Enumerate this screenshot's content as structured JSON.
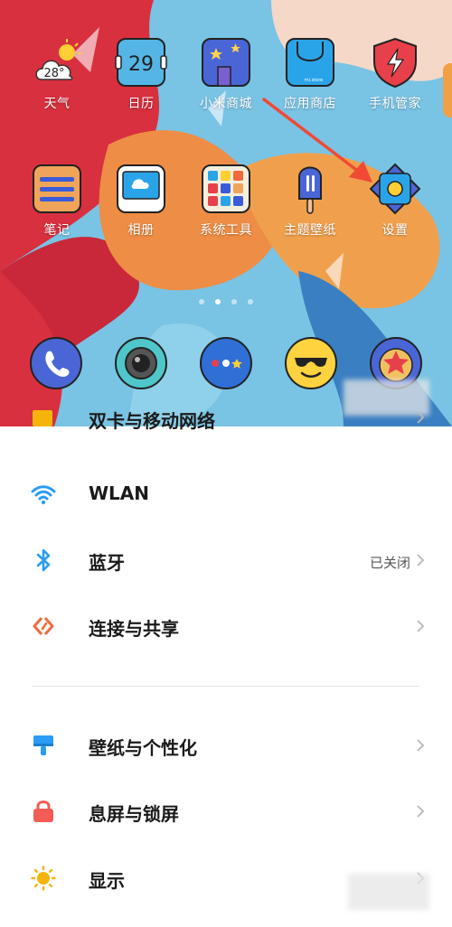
{
  "home": {
    "weather_temp": "28°",
    "calendar_day": "29",
    "store_logo_text": "mi.store",
    "apps_row1": [
      {
        "label": "天气"
      },
      {
        "label": "日历"
      },
      {
        "label": "小米商城"
      },
      {
        "label": "应用商店"
      },
      {
        "label": "手机管家"
      }
    ],
    "apps_row2": [
      {
        "label": "笔记"
      },
      {
        "label": "相册"
      },
      {
        "label": "系统工具"
      },
      {
        "label": "主题壁纸"
      },
      {
        "label": "设置"
      }
    ],
    "dock": [
      {
        "icon": "phone-icon"
      },
      {
        "icon": "camera-icon"
      },
      {
        "icon": "messages-icon"
      },
      {
        "icon": "emoji-icon"
      },
      {
        "icon": "browser-icon"
      }
    ],
    "page_count": 4,
    "active_page": 2,
    "colors": {
      "arrow": "#f04a35"
    }
  },
  "settings": {
    "partial_item_label": "双卡与移动网络",
    "items": [
      {
        "label": "WLAN",
        "icon": "wifi-icon"
      },
      {
        "label": "蓝牙",
        "status": "已关闭",
        "icon": "bluetooth-icon"
      },
      {
        "label": "连接与共享",
        "icon": "share-icon"
      },
      {
        "label": "壁纸与个性化",
        "icon": "paintbrush-icon"
      },
      {
        "label": "息屏与锁屏",
        "icon": "lock-icon"
      },
      {
        "label": "显示",
        "icon": "sun-icon"
      }
    ]
  }
}
